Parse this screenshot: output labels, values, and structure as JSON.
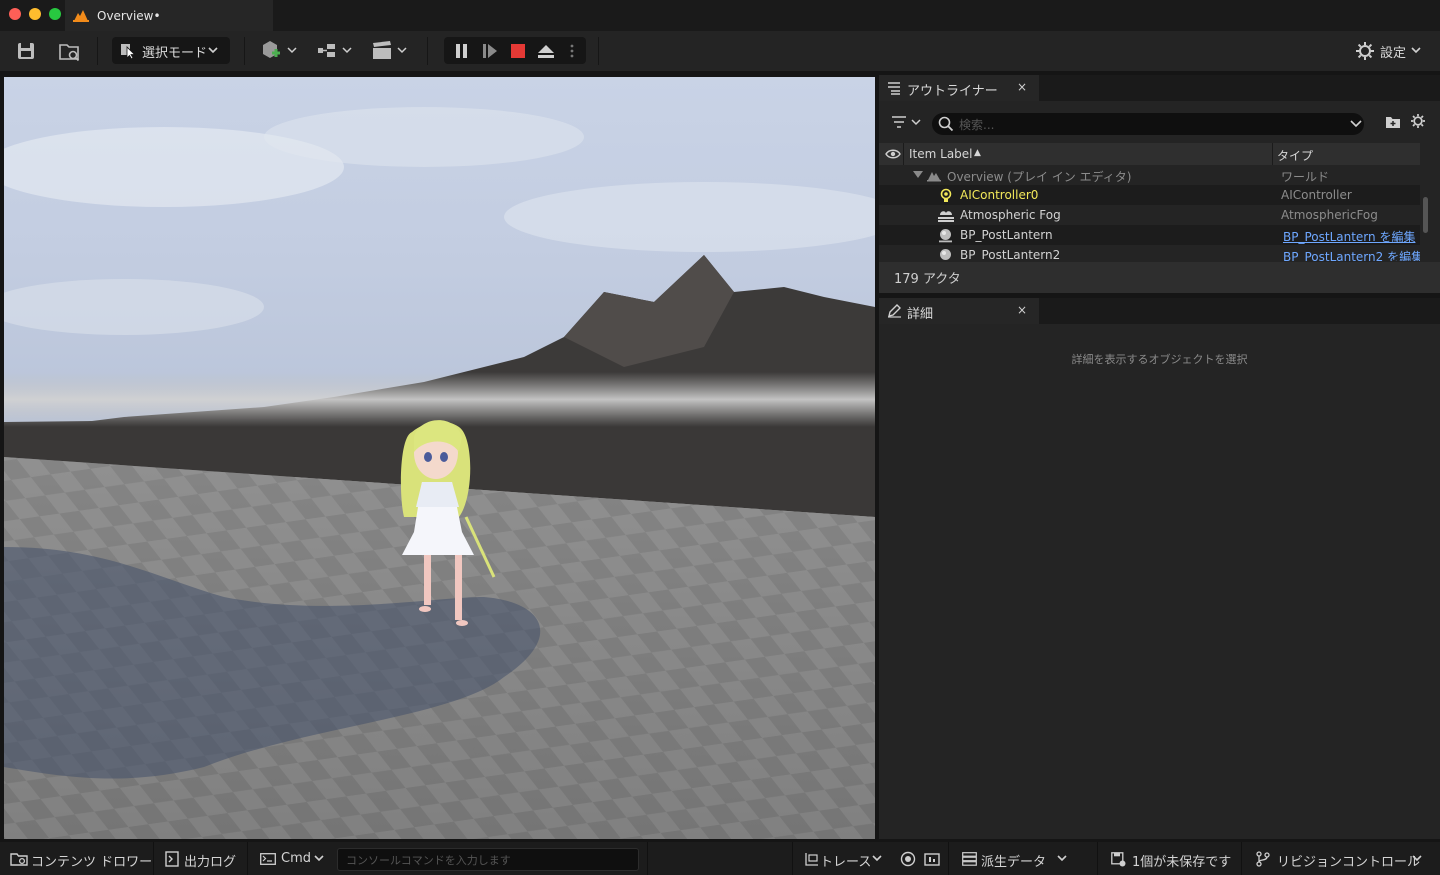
{
  "window": {
    "title": "Overview•"
  },
  "toolbar": {
    "select_mode_label": "選択モード",
    "settings_label": "設定",
    "play_controls": [
      "pause",
      "step",
      "stop",
      "eject"
    ]
  },
  "outliner": {
    "tab_title": "アウトライナー",
    "close_glyph": "×",
    "search_placeholder": "検索...",
    "columns": {
      "label": "Item Label",
      "sort_glyph": "▲",
      "type": "タイプ"
    },
    "rows": [
      {
        "name": "Overview (プレイ イン エディタ)",
        "type": "ワールド",
        "icon": "world-icon"
      },
      {
        "name": "AIController0",
        "type": "AIController",
        "icon": "controller-icon"
      },
      {
        "name": "Atmospheric Fog",
        "type": "AtmosphericFog",
        "icon": "fog-icon"
      },
      {
        "name": "BP_PostLantern",
        "type": "BP_PostLantern を編集",
        "icon": "sphere-icon"
      },
      {
        "name": "BP_PostLantern2",
        "type": "BP_PostLantern2 を編集",
        "icon": "sphere-icon"
      }
    ],
    "actor_count": "179 アクタ"
  },
  "details": {
    "tab_title": "詳細",
    "close_glyph": "×",
    "empty_message": "詳細を表示するオブジェクトを選択"
  },
  "statusbar": {
    "content_drawer": "コンテンツ ドロワー",
    "output_log": "出力ログ",
    "cmd_label": "Cmd",
    "console_placeholder": "コンソールコマンドを入力します",
    "trace": "トレース",
    "derived_data": "派生データ",
    "unsaved": "1個が未保存です",
    "revision_control": "リビジョンコントロール"
  },
  "colors": {
    "accent_blue": "#2d7fe0",
    "stop_red": "#e53935",
    "selected_yellow": "#f2e85a",
    "link_blue": "#6ea7ff"
  }
}
